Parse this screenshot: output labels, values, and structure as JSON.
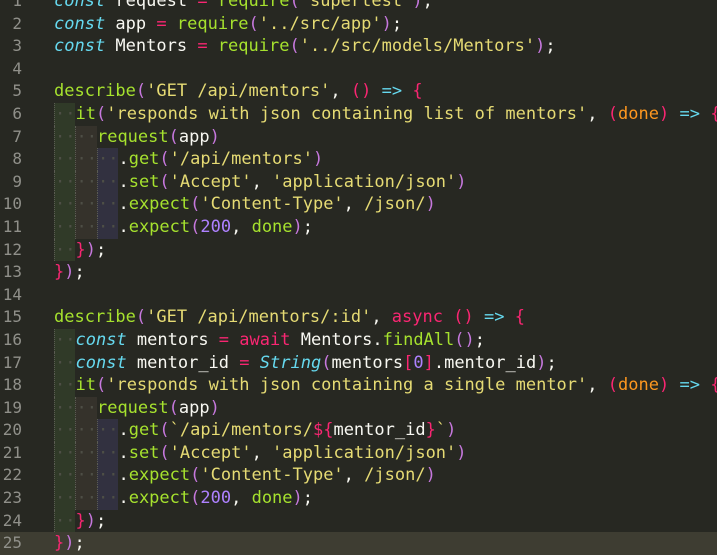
{
  "editor": {
    "theme_colors": {
      "background": "#272822",
      "current_line": "#3e3d32",
      "gutter_text": "#90908a",
      "keyword": "#66d9ef",
      "operator": "#f92672",
      "function": "#a6e22e",
      "string": "#e6db74",
      "number": "#ae81ff",
      "text": "#f8f8f2"
    },
    "current_line": 25,
    "lines": [
      {
        "n": "1",
        "indent": 0,
        "tokens": [
          [
            "kw-i",
            "const"
          ],
          [
            "plain",
            " request "
          ],
          [
            "op",
            "="
          ],
          [
            "plain",
            " "
          ],
          [
            "fn",
            "require"
          ],
          [
            "paren1",
            "("
          ],
          [
            "str",
            "'supertest'"
          ],
          [
            "paren1",
            ")"
          ],
          [
            "plain",
            ";"
          ]
        ]
      },
      {
        "n": "2",
        "indent": 0,
        "tokens": [
          [
            "kw-i",
            "const"
          ],
          [
            "plain",
            " app "
          ],
          [
            "op",
            "="
          ],
          [
            "plain",
            " "
          ],
          [
            "fn",
            "require"
          ],
          [
            "paren1",
            "("
          ],
          [
            "str",
            "'../src/app'"
          ],
          [
            "paren1",
            ")"
          ],
          [
            "plain",
            ";"
          ]
        ]
      },
      {
        "n": "3",
        "indent": 0,
        "tokens": [
          [
            "kw-i",
            "const"
          ],
          [
            "plain",
            " Mentors "
          ],
          [
            "op",
            "="
          ],
          [
            "plain",
            " "
          ],
          [
            "fn",
            "require"
          ],
          [
            "paren1",
            "("
          ],
          [
            "str",
            "'../src/models/Mentors'"
          ],
          [
            "paren1",
            ")"
          ],
          [
            "plain",
            ";"
          ]
        ]
      },
      {
        "n": "4",
        "indent": 0,
        "tokens": []
      },
      {
        "n": "5",
        "indent": 0,
        "tokens": [
          [
            "fn",
            "describe"
          ],
          [
            "paren1",
            "("
          ],
          [
            "str",
            "'GET /api/mentors'"
          ],
          [
            "plain",
            ", "
          ],
          [
            "paren2",
            "()"
          ],
          [
            "plain",
            " "
          ],
          [
            "arrow",
            "=>"
          ],
          [
            "plain",
            " "
          ],
          [
            "paren2",
            "{"
          ]
        ]
      },
      {
        "n": "6",
        "indent": 1,
        "tokens": [
          [
            "fn",
            "it"
          ],
          [
            "paren1",
            "("
          ],
          [
            "str",
            "'responds with json containing list of mentors'"
          ],
          [
            "plain",
            ", "
          ],
          [
            "paren2",
            "("
          ],
          [
            "param",
            "done"
          ],
          [
            "paren2",
            ")"
          ],
          [
            "plain",
            " "
          ],
          [
            "arrow",
            "=>"
          ],
          [
            "plain",
            " "
          ],
          [
            "paren2",
            "{"
          ]
        ]
      },
      {
        "n": "7",
        "indent": 2,
        "tokens": [
          [
            "fn",
            "request"
          ],
          [
            "paren1",
            "("
          ],
          [
            "plain",
            "app"
          ],
          [
            "paren1",
            ")"
          ]
        ]
      },
      {
        "n": "8",
        "indent": 3,
        "tokens": [
          [
            "plain",
            "."
          ],
          [
            "fn",
            "get"
          ],
          [
            "paren1",
            "("
          ],
          [
            "str",
            "'/api/mentors'"
          ],
          [
            "paren1",
            ")"
          ]
        ]
      },
      {
        "n": "9",
        "indent": 3,
        "tokens": [
          [
            "plain",
            "."
          ],
          [
            "fn",
            "set"
          ],
          [
            "paren1",
            "("
          ],
          [
            "str",
            "'Accept'"
          ],
          [
            "plain",
            ", "
          ],
          [
            "str",
            "'application/json'"
          ],
          [
            "paren1",
            ")"
          ]
        ]
      },
      {
        "n": "10",
        "indent": 3,
        "tokens": [
          [
            "plain",
            "."
          ],
          [
            "fn",
            "expect"
          ],
          [
            "paren1",
            "("
          ],
          [
            "str",
            "'Content-Type'"
          ],
          [
            "plain",
            ", "
          ],
          [
            "str",
            "/json/"
          ],
          [
            "paren1",
            ")"
          ]
        ]
      },
      {
        "n": "11",
        "indent": 3,
        "tokens": [
          [
            "plain",
            "."
          ],
          [
            "fn",
            "expect"
          ],
          [
            "paren1",
            "("
          ],
          [
            "num",
            "200"
          ],
          [
            "plain",
            ", "
          ],
          [
            "fn",
            "done"
          ],
          [
            "paren1",
            ")"
          ],
          [
            "plain",
            ";"
          ]
        ]
      },
      {
        "n": "12",
        "indent": 1,
        "tokens": [
          [
            "paren2",
            "}"
          ],
          [
            "paren1",
            ")"
          ],
          [
            "plain",
            ";"
          ]
        ]
      },
      {
        "n": "13",
        "indent": 0,
        "tokens": [
          [
            "paren2",
            "}"
          ],
          [
            "paren1",
            ")"
          ],
          [
            "plain",
            ";"
          ]
        ]
      },
      {
        "n": "14",
        "indent": 0,
        "tokens": []
      },
      {
        "n": "15",
        "indent": 0,
        "tokens": [
          [
            "fn",
            "describe"
          ],
          [
            "paren1",
            "("
          ],
          [
            "str",
            "'GET /api/mentors/:id'"
          ],
          [
            "plain",
            ", "
          ],
          [
            "kw",
            "async"
          ],
          [
            "plain",
            " "
          ],
          [
            "paren2",
            "()"
          ],
          [
            "plain",
            " "
          ],
          [
            "arrow",
            "=>"
          ],
          [
            "plain",
            " "
          ],
          [
            "paren2",
            "{"
          ]
        ]
      },
      {
        "n": "16",
        "indent": 1,
        "tokens": [
          [
            "kw-i",
            "const"
          ],
          [
            "plain",
            " mentors "
          ],
          [
            "op",
            "="
          ],
          [
            "plain",
            " "
          ],
          [
            "kw",
            "await"
          ],
          [
            "plain",
            " Mentors."
          ],
          [
            "fn",
            "findAll"
          ],
          [
            "paren1",
            "()"
          ],
          [
            "plain",
            ";"
          ]
        ]
      },
      {
        "n": "17",
        "indent": 1,
        "tokens": [
          [
            "kw-i",
            "const"
          ],
          [
            "plain",
            " mentor_id "
          ],
          [
            "op",
            "="
          ],
          [
            "plain",
            " "
          ],
          [
            "kw-i",
            "String"
          ],
          [
            "paren1",
            "("
          ],
          [
            "plain",
            "mentors"
          ],
          [
            "paren2",
            "["
          ],
          [
            "num",
            "0"
          ],
          [
            "paren2",
            "]"
          ],
          [
            "plain",
            ".mentor_id"
          ],
          [
            "paren1",
            ")"
          ],
          [
            "plain",
            ";"
          ]
        ]
      },
      {
        "n": "18",
        "indent": 1,
        "tokens": [
          [
            "fn",
            "it"
          ],
          [
            "paren1",
            "("
          ],
          [
            "str",
            "'responds with json containing a single mentor'"
          ],
          [
            "plain",
            ", "
          ],
          [
            "paren2",
            "("
          ],
          [
            "param",
            "done"
          ],
          [
            "paren2",
            ")"
          ],
          [
            "plain",
            " "
          ],
          [
            "arrow",
            "=>"
          ],
          [
            "plain",
            " "
          ],
          [
            "paren2",
            "{"
          ]
        ]
      },
      {
        "n": "19",
        "indent": 2,
        "tokens": [
          [
            "fn",
            "request"
          ],
          [
            "paren1",
            "("
          ],
          [
            "plain",
            "app"
          ],
          [
            "paren1",
            ")"
          ]
        ]
      },
      {
        "n": "20",
        "indent": 3,
        "tokens": [
          [
            "plain",
            "."
          ],
          [
            "fn",
            "get"
          ],
          [
            "paren1",
            "("
          ],
          [
            "str",
            "`/api/mentors/"
          ],
          [
            "op",
            "${"
          ],
          [
            "plain",
            "mentor_id"
          ],
          [
            "op",
            "}"
          ],
          [
            "str",
            "`"
          ],
          [
            "paren1",
            ")"
          ]
        ]
      },
      {
        "n": "21",
        "indent": 3,
        "tokens": [
          [
            "plain",
            "."
          ],
          [
            "fn",
            "set"
          ],
          [
            "paren1",
            "("
          ],
          [
            "str",
            "'Accept'"
          ],
          [
            "plain",
            ", "
          ],
          [
            "str",
            "'application/json'"
          ],
          [
            "paren1",
            ")"
          ]
        ]
      },
      {
        "n": "22",
        "indent": 3,
        "tokens": [
          [
            "plain",
            "."
          ],
          [
            "fn",
            "expect"
          ],
          [
            "paren1",
            "("
          ],
          [
            "str",
            "'Content-Type'"
          ],
          [
            "plain",
            ", "
          ],
          [
            "str",
            "/json/"
          ],
          [
            "paren1",
            ")"
          ]
        ]
      },
      {
        "n": "23",
        "indent": 3,
        "tokens": [
          [
            "plain",
            "."
          ],
          [
            "fn",
            "expect"
          ],
          [
            "paren1",
            "("
          ],
          [
            "num",
            "200"
          ],
          [
            "plain",
            ", "
          ],
          [
            "fn",
            "done"
          ],
          [
            "paren1",
            ")"
          ],
          [
            "plain",
            ";"
          ]
        ]
      },
      {
        "n": "24",
        "indent": 1,
        "tokens": [
          [
            "paren2",
            "}"
          ],
          [
            "paren1",
            ")"
          ],
          [
            "plain",
            ";"
          ]
        ]
      },
      {
        "n": "25",
        "indent": 0,
        "tokens": [
          [
            "paren2",
            "}"
          ],
          [
            "paren1",
            ")"
          ],
          [
            "plain",
            ";"
          ]
        ]
      }
    ]
  }
}
